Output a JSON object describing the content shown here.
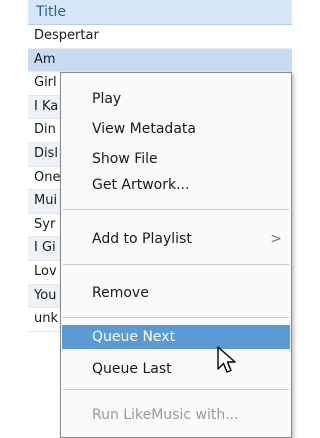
{
  "list": {
    "header": "Title",
    "rows": [
      "Despertar",
      "Am",
      "Girl",
      "I Ka",
      "Din",
      "Disl",
      "One",
      "Mui",
      "Syr",
      "I Gi",
      "Lov",
      "You",
      "unk"
    ]
  },
  "context_menu": {
    "items": [
      {
        "label": "Play"
      },
      {
        "label": "View Metadata"
      },
      {
        "label": "Show File"
      },
      {
        "label": "Get Artwork..."
      },
      {
        "label": "Add to Playlist",
        "submenu_arrow": ">"
      },
      {
        "label": "Remove"
      },
      {
        "label": "Queue Next",
        "highlighted": true
      },
      {
        "label": "Queue Last"
      },
      {
        "label": "Run LikeMusic with...",
        "disabled": true
      }
    ]
  },
  "colors": {
    "header_bg": "#d6e6f6",
    "selection_bg": "#c7dcf3",
    "highlight": "#5a9bd5"
  },
  "icons": [
    "arrow-cursor-icon",
    "chevron-right-icon"
  ]
}
